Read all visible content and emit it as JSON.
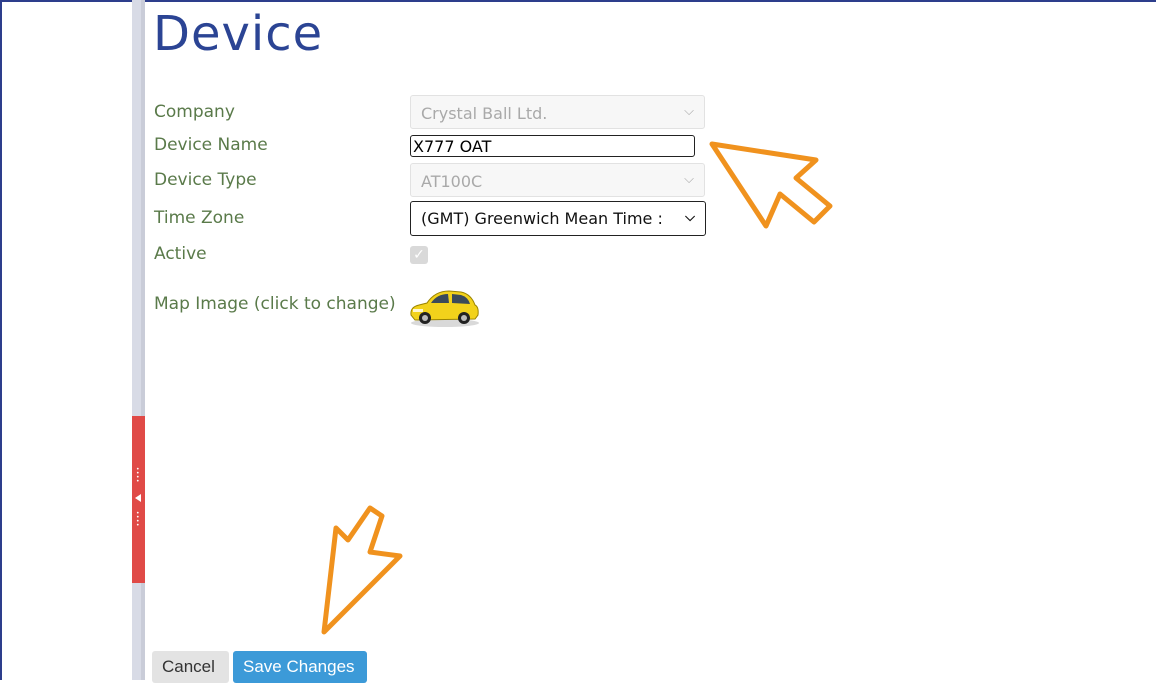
{
  "page": {
    "title": "Device"
  },
  "form": {
    "company": {
      "label": "Company",
      "value": "Crystal Ball Ltd."
    },
    "device_name": {
      "label": "Device Name",
      "value": "X777 OAT"
    },
    "device_type": {
      "label": "Device Type",
      "value": "AT100C"
    },
    "time_zone": {
      "label": "Time Zone",
      "value": "(GMT) Greenwich Mean Time : "
    },
    "active": {
      "label": "Active",
      "checked": true
    },
    "map_image": {
      "label": "Map Image (click to change)",
      "icon": "yellow-car-icon"
    }
  },
  "actions": {
    "cancel_label": "Cancel",
    "save_label": "Save Changes"
  },
  "colors": {
    "title": "#2b4494",
    "label": "#5a7a4a",
    "save_button": "#3c9ad8",
    "collapse_handle": "#e04a47",
    "annotation_arrow": "#f0921e"
  }
}
